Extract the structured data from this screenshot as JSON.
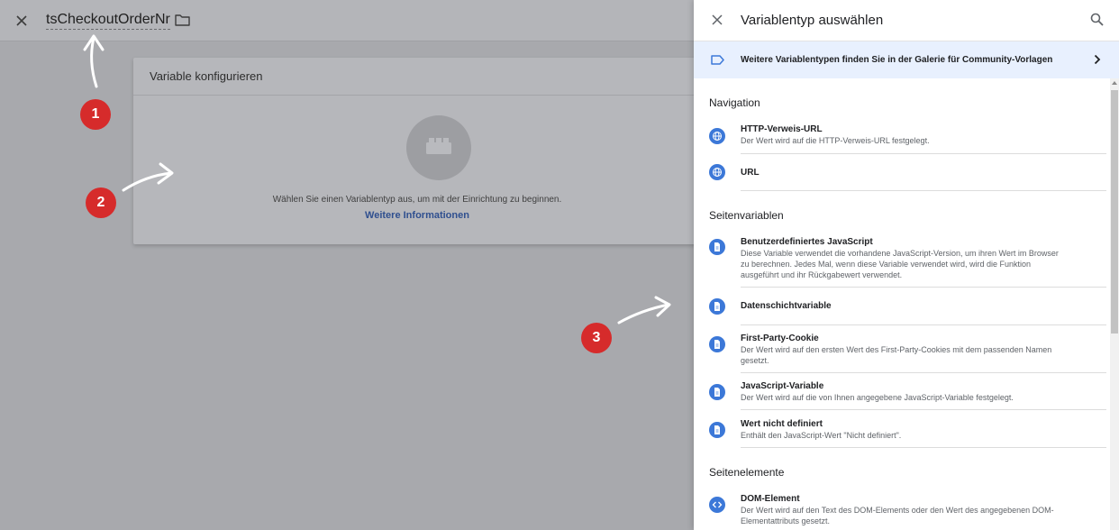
{
  "editor": {
    "variable_name": "tsCheckoutOrderNr",
    "card_title": "Variable konfigurieren",
    "card_hint": "Wählen Sie einen Variablentyp aus, um mit der Einrichtung zu beginnen.",
    "card_link": "Weitere Informationen"
  },
  "annotations": [
    "1",
    "2",
    "3"
  ],
  "drawer": {
    "title": "Variablentyp auswählen",
    "gallery_text": "Weitere Variablentypen finden Sie in der Galerie für Community-Vorlagen",
    "sections": [
      {
        "title": "Navigation",
        "items": [
          {
            "name": "HTTP-Verweis-URL",
            "desc": "Der Wert wird auf die HTTP-Verweis-URL festgelegt.",
            "icon": "globe-icon"
          },
          {
            "name": "URL",
            "desc": "",
            "icon": "globe-icon"
          }
        ]
      },
      {
        "title": "Seitenvariablen",
        "items": [
          {
            "name": "Benutzerdefiniertes JavaScript",
            "desc": "Diese Variable verwendet die vorhandene JavaScript-Version, um ihren Wert im Browser zu berechnen. Jedes Mal, wenn diese Variable verwendet wird, wird die Funktion ausgeführt und ihr Rückgabewert verwendet.",
            "icon": "document-icon"
          },
          {
            "name": "Datenschichtvariable",
            "desc": "",
            "icon": "document-icon"
          },
          {
            "name": "First-Party-Cookie",
            "desc": "Der Wert wird auf den ersten Wert des First-Party-Cookies mit dem passenden Namen gesetzt.",
            "icon": "document-icon"
          },
          {
            "name": "JavaScript-Variable",
            "desc": "Der Wert wird auf die von Ihnen angegebene JavaScript-Variable festgelegt.",
            "icon": "document-icon"
          },
          {
            "name": "Wert nicht definiert",
            "desc": "Enthält den JavaScript-Wert \"Nicht definiert\".",
            "icon": "document-icon"
          }
        ]
      },
      {
        "title": "Seitenelemente",
        "items": [
          {
            "name": "DOM-Element",
            "desc": "Der Wert wird auf den Text des DOM-Elements oder den Wert des angegebenen DOM-Elementattributs gesetzt.",
            "icon": "code-icon"
          }
        ]
      }
    ]
  },
  "colors": {
    "accent": "#3c78d8",
    "badge": "#d62b2b",
    "gallery_bg": "#e8f0fe",
    "overlay": "#a8a9ad"
  }
}
